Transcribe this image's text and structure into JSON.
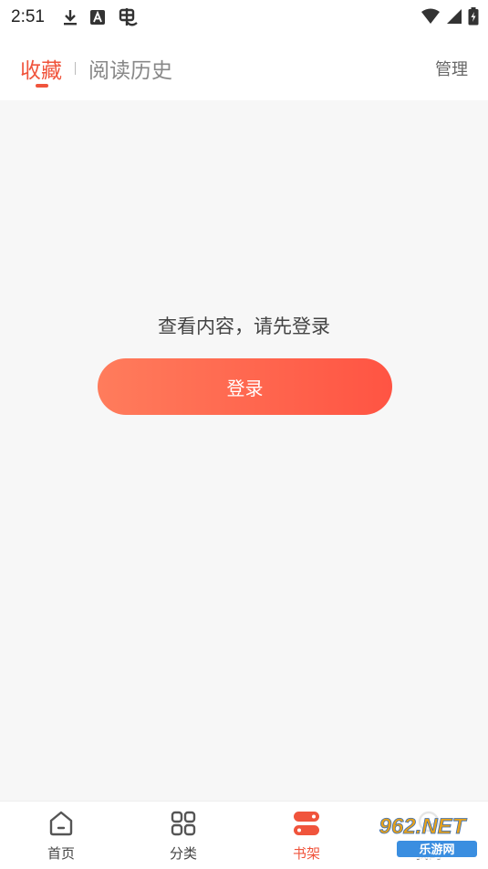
{
  "status_bar": {
    "time": "2:51"
  },
  "header": {
    "tabs": [
      {
        "label": "收藏",
        "active": true
      },
      {
        "label": "阅读历史",
        "active": false
      }
    ],
    "manage_label": "管理"
  },
  "main": {
    "prompt": "查看内容，请先登录",
    "login_label": "登录"
  },
  "bottom_nav": {
    "items": [
      {
        "label": "首页",
        "icon": "home-icon"
      },
      {
        "label": "分类",
        "icon": "grid-icon"
      },
      {
        "label": "书架",
        "icon": "bookshelf-icon",
        "active": true
      },
      {
        "label": "我的",
        "icon": "profile-icon"
      }
    ]
  },
  "watermark": {
    "line1": "962.NET",
    "line2": "乐游网"
  },
  "colors": {
    "accent": "#f0543c",
    "button_start": "#ff7c5c",
    "button_end": "#ff5443",
    "background": "#f7f7f7"
  }
}
